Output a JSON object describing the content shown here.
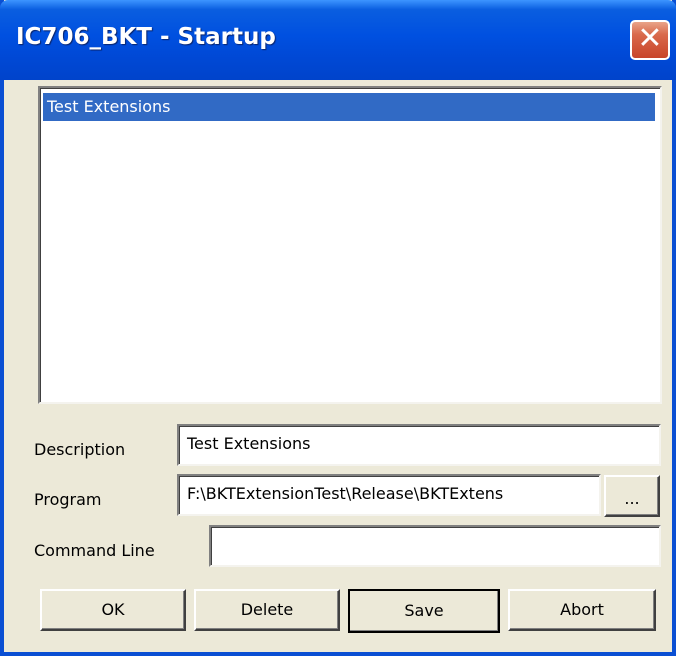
{
  "window": {
    "title": "IC706_BKT - Startup",
    "close_glyph": "✕"
  },
  "list": {
    "items": [
      {
        "label": "Test Extensions",
        "selected": true
      }
    ]
  },
  "form": {
    "description_label": "Description",
    "description_value": "Test Extensions",
    "program_label": "Program",
    "program_value": "F:\\BKTExtensionTest\\Release\\BKTExtens",
    "browse_label": "...",
    "command_line_label": "Command Line",
    "command_line_value": ""
  },
  "buttons": {
    "ok": "OK",
    "delete": "Delete",
    "save": "Save",
    "abort": "Abort"
  },
  "colors": {
    "titlebar": "#0050e0",
    "selection": "#316ac5",
    "face": "#ece9d8",
    "close": "#d9694b"
  }
}
